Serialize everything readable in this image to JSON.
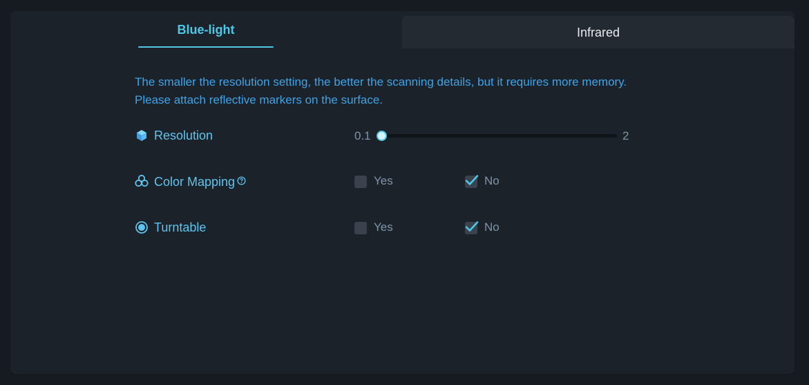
{
  "tabs": [
    {
      "label": "Blue-light",
      "active": true
    },
    {
      "label": "Infrared",
      "active": false
    }
  ],
  "description": {
    "line1": "The smaller the resolution setting, the better the scanning details, but it requires more memory.",
    "line2": "Please attach reflective markers on the surface."
  },
  "settings": {
    "resolution": {
      "label": "Resolution",
      "icon": "cube-icon",
      "min_label": "0.1",
      "max_label": "2",
      "min": 0.1,
      "max": 2,
      "value": 0.1
    },
    "color_mapping": {
      "label": "Color Mapping",
      "icon": "color-spheres-icon",
      "help_icon": "help-circle-icon",
      "yes_label": "Yes",
      "no_label": "No",
      "yes_checked": false,
      "no_checked": true
    },
    "turntable": {
      "label": "Turntable",
      "icon": "turntable-icon",
      "yes_label": "Yes",
      "no_label": "No",
      "yes_checked": false,
      "no_checked": true
    }
  },
  "colors": {
    "accent": "#4fc7e6",
    "label_blue": "#5ec4ef",
    "description_blue": "#3fa3e8",
    "panel_bg": "#1b222a",
    "page_bg": "#161b22"
  }
}
